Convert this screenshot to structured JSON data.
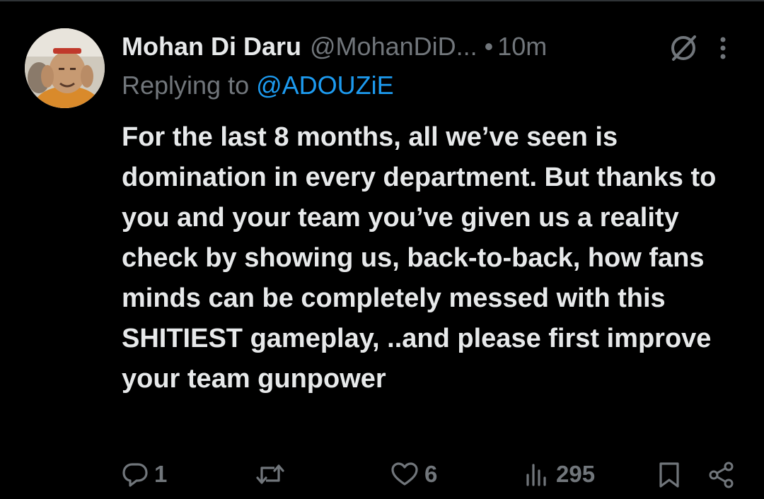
{
  "post": {
    "author": {
      "display_name": "Mohan Di Daru",
      "handle": "@MohanDiD...",
      "avatar_icon": "profile-photo-icon"
    },
    "separator": "•",
    "time": "10m",
    "replying_to_label": "Replying to",
    "replying_to_handle": "@ADOUZiE",
    "text": "For the last 8 months, all we’ve seen is domination in every department. But thanks to you and your team you’ve given us a reality check by showing us, back-to-back, how fans minds can be completely messed with this SHITIEST gameplay, ..and please first improve your team gunpower"
  },
  "actions": {
    "reply_count": "1",
    "repost_count": "",
    "like_count": "6",
    "views_count": "295"
  },
  "icons": {
    "grok": "grok-icon",
    "more": "more-icon",
    "reply": "reply-icon",
    "repost": "repost-icon",
    "like": "heart-icon",
    "views": "views-icon",
    "bookmark": "bookmark-icon",
    "share": "share-icon"
  },
  "colors": {
    "background": "#000000",
    "text_primary": "#e7e9ea",
    "text_secondary": "#71767b",
    "accent": "#1d9bf0"
  }
}
